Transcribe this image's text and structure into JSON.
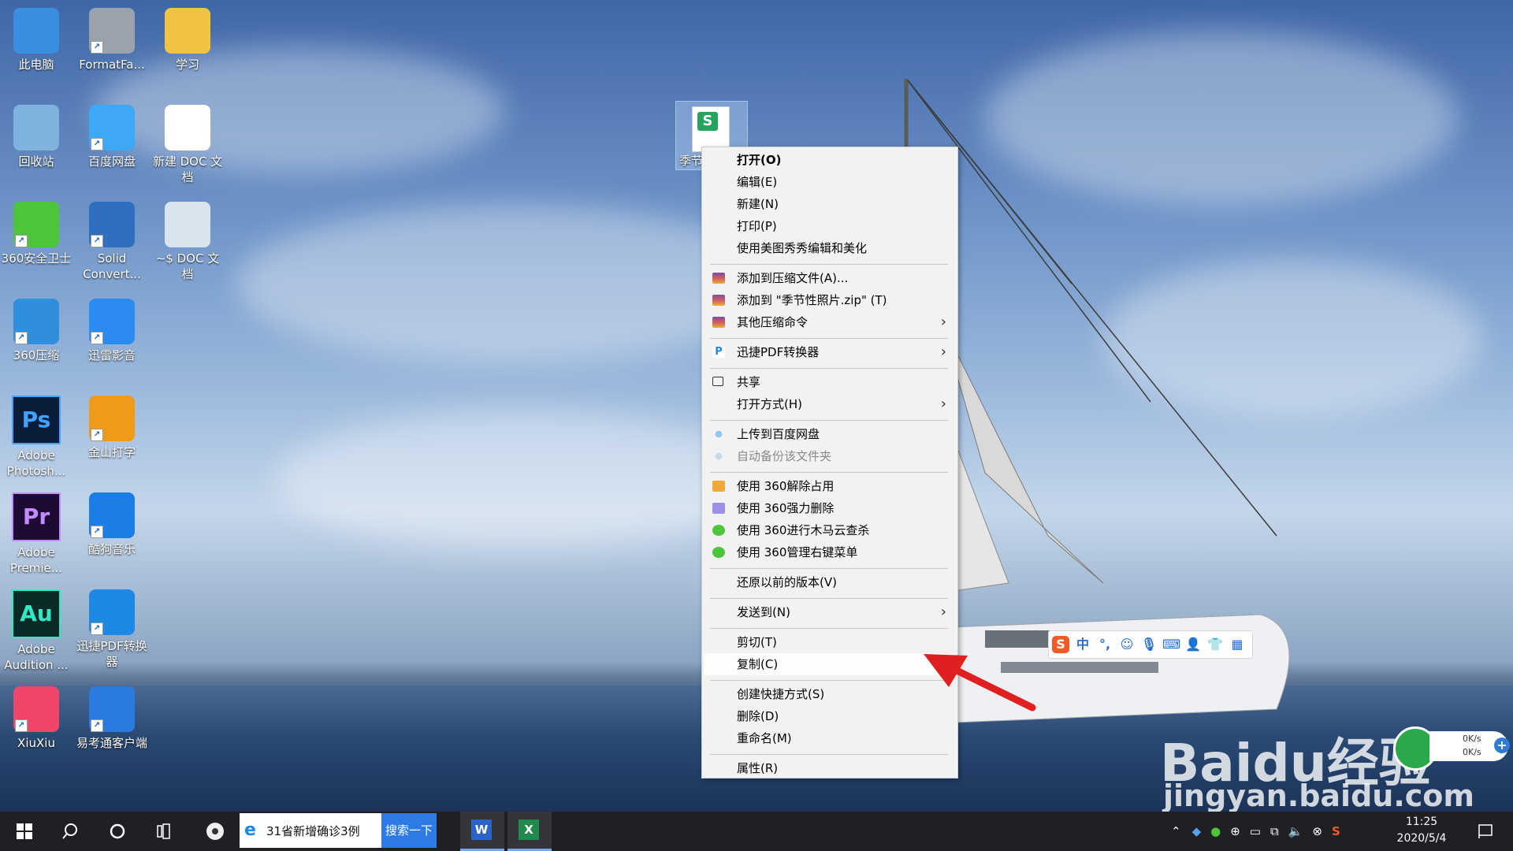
{
  "desktop": {
    "icons": [
      {
        "label": "此电脑",
        "icon": "computer-icon",
        "color": "#3b8de0"
      },
      {
        "label": "FormatFa...",
        "icon": "format-factory-icon",
        "color": "#9aa3ad"
      },
      {
        "label": "学习",
        "icon": "folder-icon",
        "color": "#f0c341"
      },
      {
        "label": "回收站",
        "icon": "recycle-bin-icon",
        "color": "#7fb2dc"
      },
      {
        "label": "百度网盘",
        "icon": "baidu-netdisk-icon",
        "color": "#3da8f5"
      },
      {
        "label": "新建 DOC 文档",
        "icon": "doc-file-icon",
        "color": "#ffffff"
      },
      {
        "label": "360安全卫士",
        "icon": "360-security-icon",
        "color": "#4cc53a"
      },
      {
        "label": "Solid Convert...",
        "icon": "solid-converter-icon",
        "color": "#2e6fbf"
      },
      {
        "label": "~$ DOC 文档",
        "icon": "doc-temp-icon",
        "color": "#d9e4ef"
      },
      {
        "label": "360压缩",
        "icon": "360-zip-icon",
        "color": "#2f8fdc"
      },
      {
        "label": "迅雷影音",
        "icon": "xunlei-player-icon",
        "color": "#2b8bf0"
      },
      {
        "label": "Adobe Photosh...",
        "icon": "photoshop-icon",
        "color": "#0a1e3c"
      },
      {
        "label": "金山打字",
        "icon": "jinshan-typing-icon",
        "color": "#f09a1a"
      },
      {
        "label": "Adobe Premie...",
        "icon": "premiere-icon",
        "color": "#1e0b33"
      },
      {
        "label": "酷狗音乐",
        "icon": "kugou-music-icon",
        "color": "#1b7ee6"
      },
      {
        "label": "Adobe Audition ...",
        "icon": "audition-icon",
        "color": "#0a2a25"
      },
      {
        "label": "迅捷PDF转换器",
        "icon": "xunjie-pdf-icon",
        "color": "#1e88e5"
      },
      {
        "label": "XiuXiu",
        "icon": "xiuxiu-icon",
        "color": "#f0466a"
      },
      {
        "label": "易考通客户端",
        "icon": "yikaotong-icon",
        "color": "#2a7be0"
      }
    ],
    "glyph_text": {
      "photoshop": "Ps",
      "premiere": "Pr",
      "audition": "Au",
      "sheet": "S"
    },
    "selected_file": {
      "label": "季节"
    }
  },
  "context_menu": {
    "items": [
      {
        "label": "打开(O)"
      },
      {
        "label": "编辑(E)"
      },
      {
        "label": "新建(N)"
      },
      {
        "label": "打印(P)"
      },
      {
        "label": "使用美图秀秀编辑和美化"
      },
      {
        "label": "添加到压缩文件(A)..."
      },
      {
        "label": "添加到 \"季节性照片.zip\" (T)"
      },
      {
        "label": "其他压缩命令"
      },
      {
        "label": "迅捷PDF转换器"
      },
      {
        "label": "共享"
      },
      {
        "label": "打开方式(H)"
      },
      {
        "label": "上传到百度网盘"
      },
      {
        "label": "自动备份该文件夹"
      },
      {
        "label": "使用 360解除占用"
      },
      {
        "label": "使用 360强力删除"
      },
      {
        "label": "使用 360进行木马云查杀"
      },
      {
        "label": "使用 360管理右键菜单"
      },
      {
        "label": "还原以前的版本(V)"
      },
      {
        "label": "发送到(N)"
      },
      {
        "label": "剪切(T)"
      },
      {
        "label": "复制(C)"
      },
      {
        "label": "创建快捷方式(S)"
      },
      {
        "label": "删除(D)"
      },
      {
        "label": "重命名(M)"
      },
      {
        "label": "属性(R)"
      }
    ],
    "submenu_glyph": "›"
  },
  "ime_bar": {
    "items": [
      "S",
      "中",
      "°,",
      "☺",
      "🎙",
      "⌨",
      "👤",
      "👕",
      "▦"
    ]
  },
  "net_widget": {
    "upload": "0K/s",
    "download": "0K/s"
  },
  "watermark": {
    "brand": "Baidu经验",
    "url": "jingyan.baidu.com"
  },
  "taskbar": {
    "search_text": "31省新增确诊3例",
    "search_button": "搜索一下",
    "time": "11:25",
    "date": "2020/5/4"
  }
}
